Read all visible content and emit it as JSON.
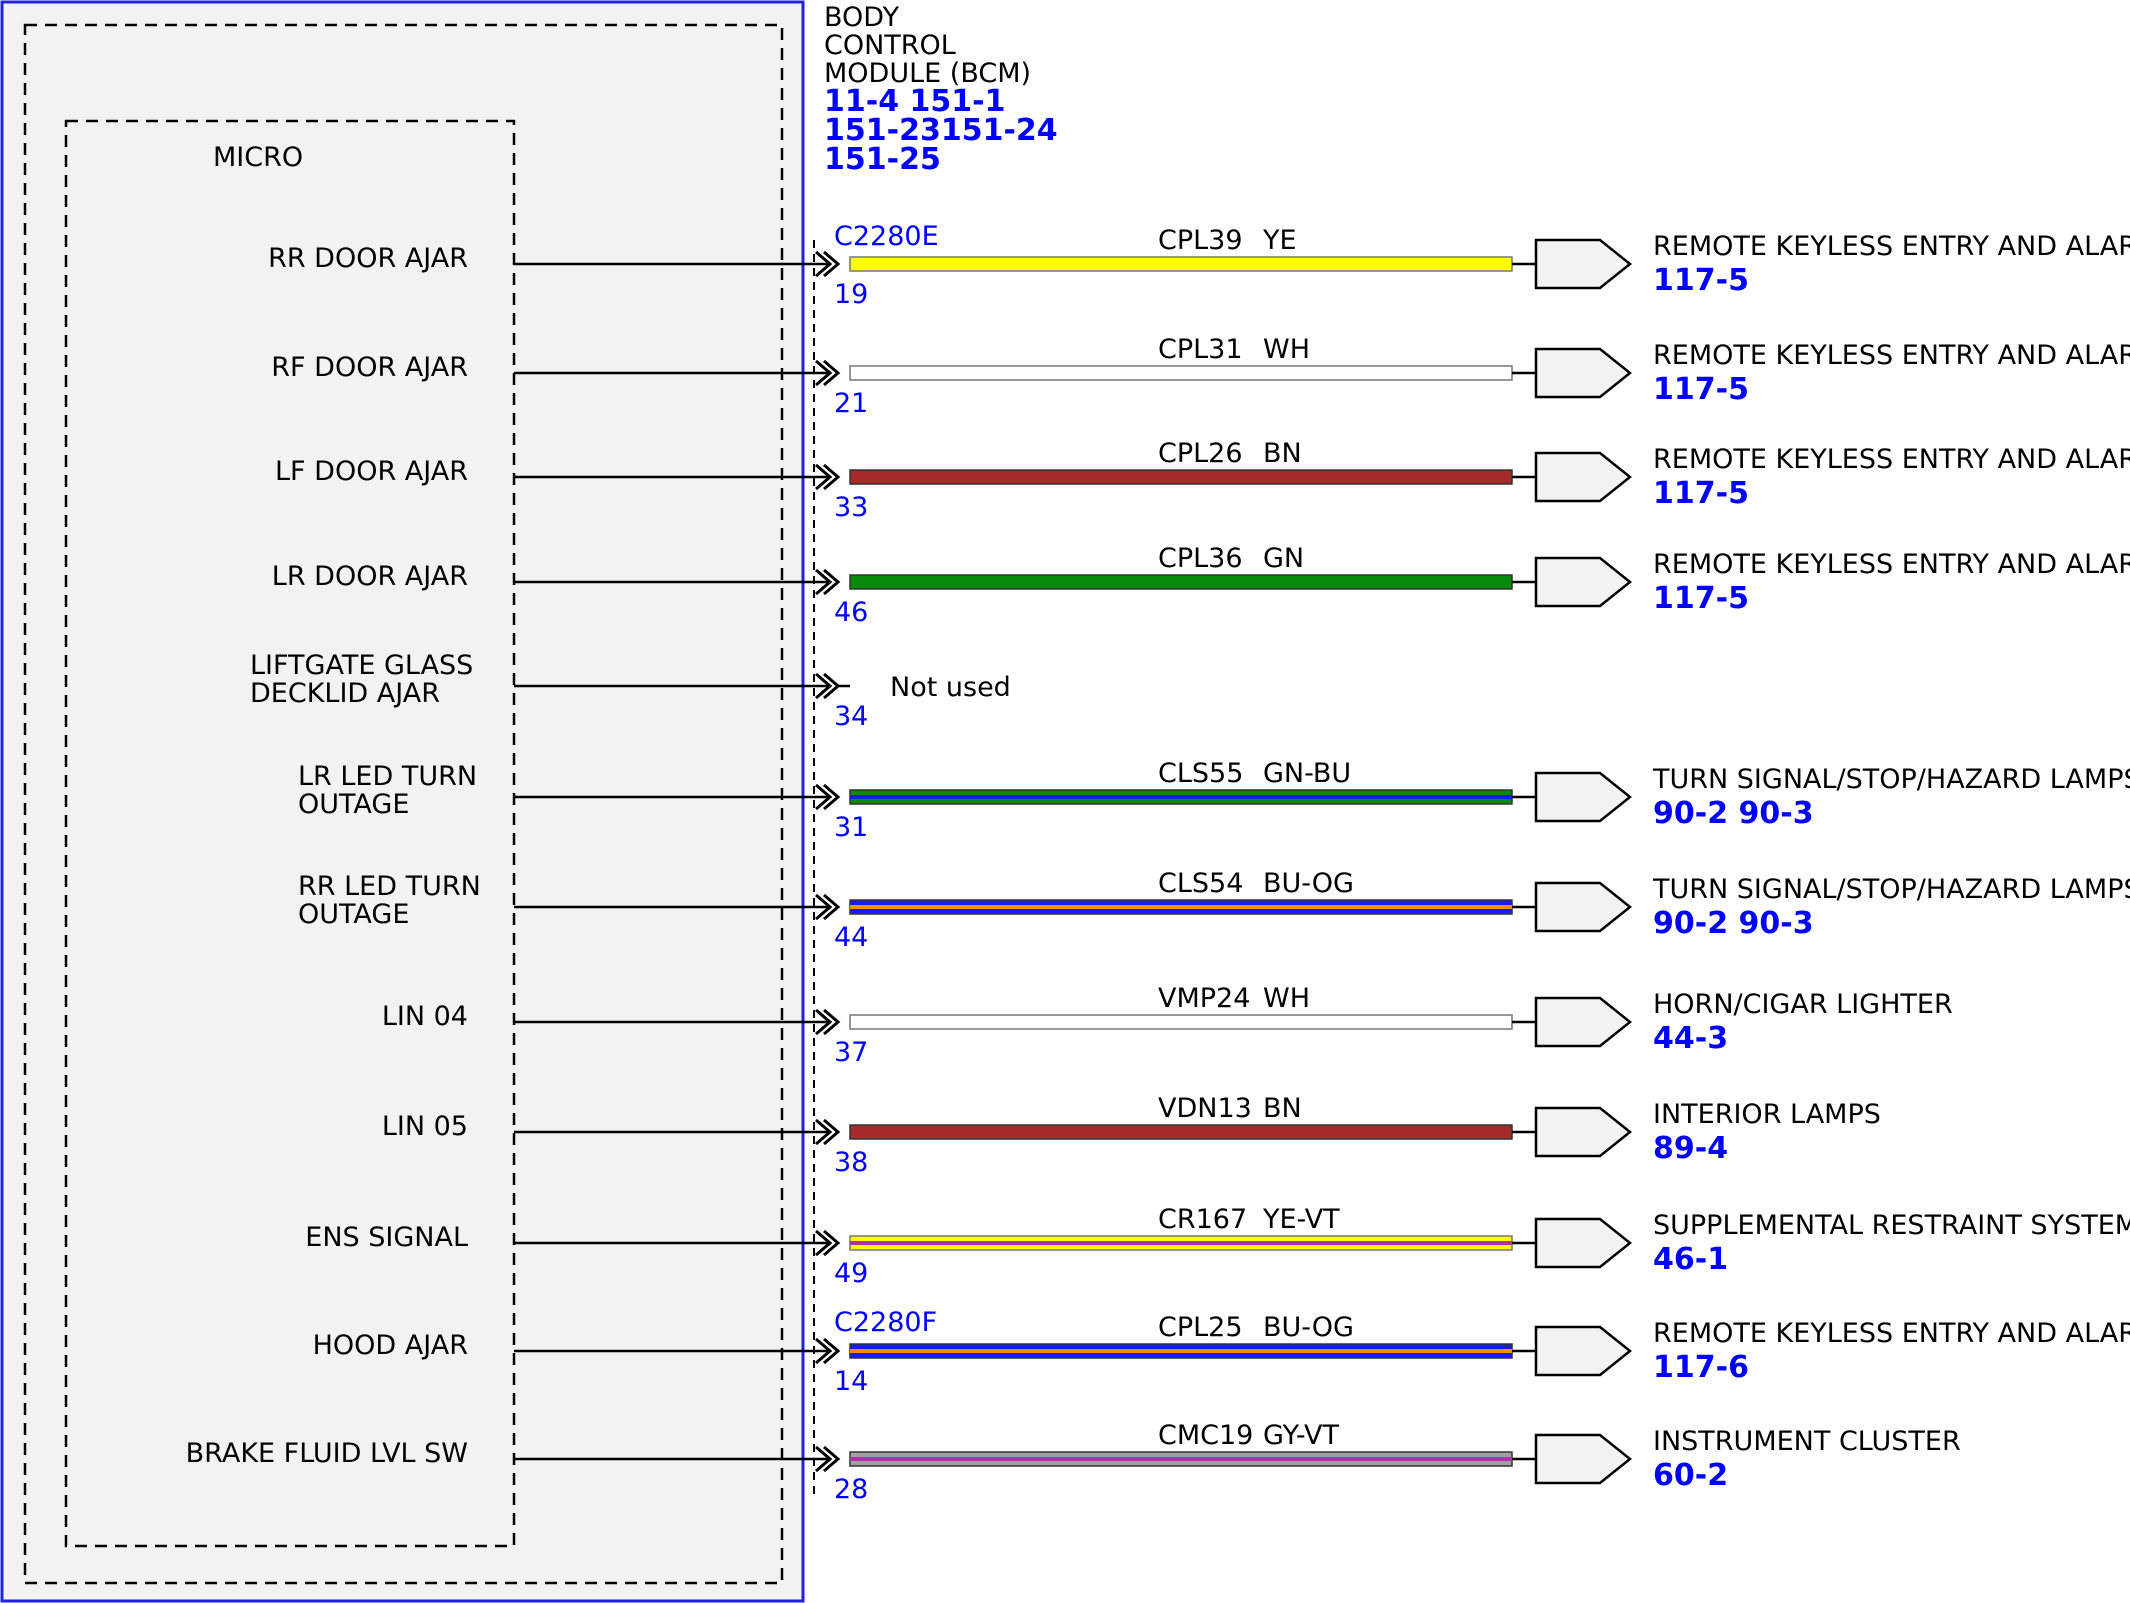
{
  "module": {
    "title_lines": [
      "BODY",
      "CONTROL",
      "MODULE (BCM)"
    ],
    "ref_lines": [
      "11-4  151-1",
      "151-23151-24",
      "151-25"
    ],
    "inner_label": "MICRO"
  },
  "connectors": [
    "C2280E",
    "C2280F"
  ],
  "circuits": [
    {
      "label": [
        "RR DOOR AJAR"
      ],
      "pin": "19",
      "code": "CPL39",
      "color_code": "YE",
      "colors": [
        "#ffff00"
      ],
      "dest": "REMOTE KEYLESS ENTRY AND ALARM",
      "refs": "117-5"
    },
    {
      "label": [
        "RF DOOR AJAR"
      ],
      "pin": "21",
      "code": "CPL31",
      "color_code": "WH",
      "colors": [
        "#ffffff"
      ],
      "dest": "REMOTE KEYLESS ENTRY AND ALARM",
      "refs": "117-5"
    },
    {
      "label": [
        "LF DOOR AJAR"
      ],
      "pin": "33",
      "code": "CPL26",
      "color_code": "BN",
      "colors": [
        "#a52a2a"
      ],
      "dest": "REMOTE KEYLESS ENTRY AND ALARM",
      "refs": "117-5"
    },
    {
      "label": [
        "LR DOOR AJAR"
      ],
      "pin": "46",
      "code": "CPL36",
      "color_code": "GN",
      "colors": [
        "#0a8a0a"
      ],
      "dest": "REMOTE KEYLESS ENTRY AND ALARM",
      "refs": "117-5"
    },
    {
      "label": [
        "LIFTGATE GLASS",
        "DECKLID AJAR"
      ],
      "pin": "34",
      "not_used": "Not used"
    },
    {
      "label": [
        "LR LED TURN",
        "OUTAGE"
      ],
      "pin": "31",
      "code": "CLS55",
      "color_code": "GN-BU",
      "colors": [
        "#0a8a0a",
        "#1a1aff"
      ],
      "dest": "TURN SIGNAL/STOP/HAZARD LAMPS",
      "refs": "90-2  90-3"
    },
    {
      "label": [
        "RR LED TURN",
        "OUTAGE"
      ],
      "pin": "44",
      "code": "CLS54",
      "color_code": "BU-OG",
      "colors": [
        "#1a1aff",
        "#ff8c00"
      ],
      "dest": "TURN SIGNAL/STOP/HAZARD LAMPS",
      "refs": "90-2  90-3"
    },
    {
      "label": [
        "LIN 04"
      ],
      "pin": "37",
      "code": "VMP24",
      "color_code": "WH",
      "colors": [
        "#ffffff"
      ],
      "dest": "HORN/CIGAR LIGHTER",
      "refs": "44-3"
    },
    {
      "label": [
        "LIN 05"
      ],
      "pin": "38",
      "code": "VDN13",
      "color_code": "BN",
      "colors": [
        "#a52a2a"
      ],
      "dest": "INTERIOR LAMPS",
      "refs": "89-4"
    },
    {
      "label": [
        "ENS SIGNAL"
      ],
      "pin": "49",
      "code": "CR167",
      "color_code": "YE-VT",
      "colors": [
        "#ffff00",
        "#b030b0"
      ],
      "dest": "SUPPLEMENTAL RESTRAINT SYSTEM",
      "refs": "46-1"
    },
    {
      "label": [
        "HOOD AJAR"
      ],
      "pin": "14",
      "code": "CPL25",
      "color_code": "BU-OG",
      "colors": [
        "#1a1aff",
        "#ff8c00"
      ],
      "dest": "REMOTE KEYLESS ENTRY AND ALARM",
      "refs": "117-6"
    },
    {
      "label": [
        "BRAKE FLUID LVL SW"
      ],
      "pin": "28",
      "code": "CMC19",
      "color_code": "GY-VT",
      "colors": [
        "#a0a0a0",
        "#b030b0"
      ],
      "dest": "INSTRUMENT CLUSTER",
      "refs": "60-2"
    }
  ]
}
